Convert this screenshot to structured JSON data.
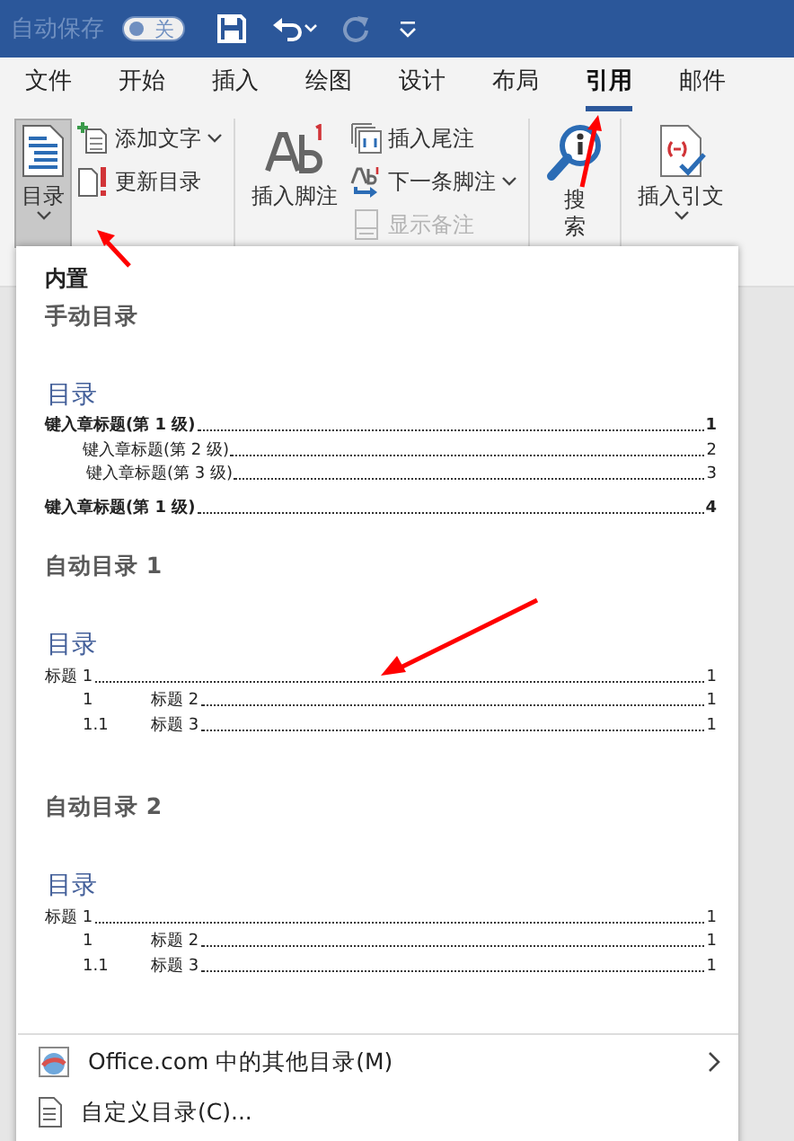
{
  "title_bar": {
    "autosave_label": "自动保存",
    "autosave_toggle": {
      "label": "关",
      "on": false
    },
    "quick_access": [
      {
        "kind": "save",
        "disabled": false
      },
      {
        "kind": "undo",
        "disabled": false
      },
      {
        "kind": "redo",
        "disabled": true
      },
      {
        "kind": "customize",
        "disabled": false
      }
    ]
  },
  "tabs": [
    {
      "label": "文件",
      "selected": false
    },
    {
      "label": "开始",
      "selected": false
    },
    {
      "label": "插入",
      "selected": false
    },
    {
      "label": "绘图",
      "selected": false
    },
    {
      "label": "设计",
      "selected": false
    },
    {
      "label": "布局",
      "selected": false
    },
    {
      "label": "引用",
      "selected": true
    },
    {
      "label": "邮件",
      "selected": false
    }
  ],
  "ribbon": {
    "groups": [
      {
        "items": [
          {
            "kind": "large",
            "label": "目录",
            "pressed": true,
            "dropdown": true
          },
          {
            "kind": "stack",
            "buttons": [
              {
                "label": "添加文字",
                "dropdown": true,
                "disabled": false
              },
              {
                "label": "更新目录",
                "dropdown": false,
                "disabled": false
              }
            ]
          }
        ]
      },
      {
        "items": [
          {
            "kind": "large",
            "label": "插入脚注",
            "pressed": false,
            "dropdown": false
          },
          {
            "kind": "stack",
            "buttons": [
              {
                "label": "插入尾注",
                "dropdown": false,
                "disabled": false
              },
              {
                "label": "下一条脚注",
                "dropdown": true,
                "disabled": false
              },
              {
                "label": "显示备注",
                "dropdown": false,
                "disabled": true
              }
            ]
          }
        ]
      },
      {
        "items": [
          {
            "kind": "large",
            "label": "搜索",
            "pressed": false,
            "dropdown": false
          }
        ]
      },
      {
        "items": [
          {
            "kind": "large",
            "label": "插入引文",
            "pressed": false,
            "dropdown": true
          }
        ]
      }
    ]
  },
  "toc_menu": {
    "section": "内置",
    "gallery": [
      {
        "kind": "manual",
        "label": "手动目录",
        "preview": {
          "heading": "目录",
          "entries": [
            {
              "text": "键入章标题(第 1 级)",
              "page": "1",
              "children": [
                {
                  "text": "键入章标题(第 2 级)",
                  "page": "2",
                  "children": [
                    {
                      "text": "键入章标题(第 3 级)",
                      "page": "3"
                    }
                  ]
                }
              ]
            },
            {
              "text": "键入章标题(第 1 级)",
              "page": "4"
            }
          ]
        }
      },
      {
        "kind": "auto",
        "label": "自动目录 1",
        "preview": {
          "heading": "目录",
          "entries": [
            {
              "text": "标题 1",
              "page": "1",
              "children": [
                {
                  "number": "1",
                  "text": "标题 2",
                  "page": "1",
                  "children": [
                    {
                      "number": "1.1",
                      "text": "标题 3",
                      "page": "1"
                    }
                  ]
                }
              ]
            }
          ]
        }
      },
      {
        "kind": "auto",
        "label": "自动目录 2",
        "preview": {
          "heading": "目录",
          "entries": [
            {
              "text": "标题 1",
              "page": "1",
              "children": [
                {
                  "number": "1",
                  "text": "标题 2",
                  "page": "1",
                  "children": [
                    {
                      "number": "1.1",
                      "text": "标题 3",
                      "page": "1"
                    }
                  ]
                }
              ]
            }
          ]
        }
      }
    ],
    "commands": [
      {
        "kind": "office",
        "label": "Office.com 中的其他目录(M)",
        "submenu": true
      },
      {
        "kind": "custom",
        "label": "自定义目录(C)...",
        "submenu": false
      }
    ]
  }
}
